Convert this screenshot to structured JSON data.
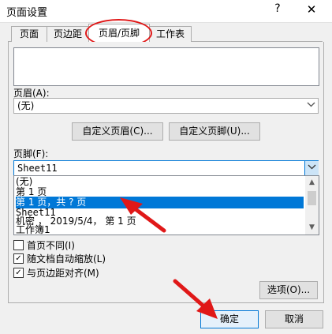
{
  "dialog": {
    "title": "页面设置",
    "help": "?",
    "close": "✕"
  },
  "tabs": [
    {
      "label": "页面"
    },
    {
      "label": "页边距"
    },
    {
      "label": "页眉/页脚"
    },
    {
      "label": "工作表"
    }
  ],
  "header": {
    "label": "页眉(A):",
    "value": "(无)",
    "custom_header_button": "自定义页眉(C)...",
    "custom_footer_button": "自定义页脚(U)..."
  },
  "footer": {
    "label": "页脚(F):",
    "value": "Sheet11",
    "options": [
      "(无)",
      "第 1 页",
      "第 1 页，共 ? 页",
      "Sheet11",
      " 机密 ， 2019/5/4， 第 1 页",
      "工作簿1"
    ],
    "selected_index": 2
  },
  "checkboxes": [
    {
      "label": "首页不同(I)",
      "checked": false
    },
    {
      "label": "随文档自动缩放(L)",
      "checked": true
    },
    {
      "label": "与页边距对齐(M)",
      "checked": true
    }
  ],
  "buttons": {
    "options": "选项(O)...",
    "ok": "确定",
    "cancel": "取消"
  },
  "icons": {
    "dropdown": "chevron-down-icon",
    "check": "✓"
  },
  "colors": {
    "selection": "#0078d7",
    "annotation": "#e01818"
  }
}
